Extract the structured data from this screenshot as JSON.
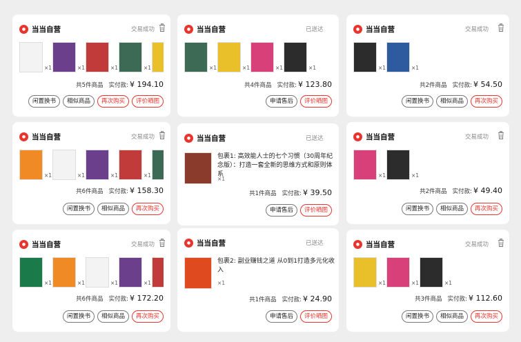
{
  "orders": [
    {
      "store": "当当自营",
      "status": "交易成功",
      "books": 5,
      "count_text": "共5件商品",
      "paid_label": "实付款:",
      "amount": "¥ 194.10",
      "buttons": [
        "闲置换书",
        "相似商品",
        "再次购买",
        "评价晒图"
      ]
    },
    {
      "store": "当当自营",
      "status": "已送达",
      "books": 4,
      "count_text": "共4件商品",
      "paid_label": "实付款:",
      "amount": "¥ 123.80",
      "buttons": [
        "申请售后",
        "评价晒图"
      ]
    },
    {
      "store": "当当自营",
      "status": "交易成功",
      "books": 2,
      "count_text": "共2件商品",
      "paid_label": "实付款:",
      "amount": "¥ 54.50",
      "buttons": [
        "闲置换书",
        "相似商品",
        "再次购买"
      ]
    },
    {
      "store": "当当自营",
      "status": "交易成功",
      "books": 6,
      "count_text": "共6件商品",
      "paid_label": "实付款:",
      "amount": "¥ 158.30",
      "buttons": [
        "闲置换书",
        "相似商品",
        "再次购买"
      ]
    },
    {
      "store": "当当自营",
      "status": "已送达",
      "package_text": "包裹1: 高效能人士的七个习惯（30周年纪念版）：打造一套全新的思维方式和原则体系",
      "qty": "×1",
      "count_text": "共1件商品",
      "paid_label": "实付款:",
      "amount": "¥ 39.50",
      "buttons": [
        "申请售后",
        "评价晒图"
      ]
    },
    {
      "store": "当当自营",
      "status": "交易成功",
      "books": 2,
      "count_text": "共2件商品",
      "paid_label": "实付款:",
      "amount": "¥ 49.40",
      "buttons": [
        "闲置换书",
        "相似商品",
        "再次购买"
      ]
    },
    {
      "store": "当当自营",
      "status": "交易成功",
      "books": 6,
      "count_text": "共6件商品",
      "paid_label": "实付款:",
      "amount": "¥ 172.20",
      "buttons": [
        "闲置换书",
        "相似商品",
        "再次购买"
      ]
    },
    {
      "store": "当当自营",
      "status": "已送达",
      "package_text": "包裹2: 副业赚钱之道 从0到1打造多元化收入",
      "qty": "×1",
      "count_text": "共1件商品",
      "paid_label": "实付款:",
      "amount": "¥ 24.90",
      "buttons": [
        "申请售后",
        "评价晒图"
      ]
    },
    {
      "store": "当当自营",
      "status": "交易成功",
      "books": 3,
      "count_text": "共3件商品",
      "paid_label": "实付款:",
      "amount": "¥ 112.60",
      "buttons": [
        "闲置换书",
        "相似商品",
        "再次购买"
      ]
    }
  ],
  "qty_label": "×1",
  "colors": {
    "brand": "#e8352e",
    "book_palette": [
      "#f3f3f3",
      "#6b3f8c",
      "#c23b3b",
      "#3d6a55",
      "#e9c02a",
      "#d8407a",
      "#2c2c2c",
      "#2e5aa0",
      "#1a7a4a",
      "#f08a24"
    ]
  }
}
